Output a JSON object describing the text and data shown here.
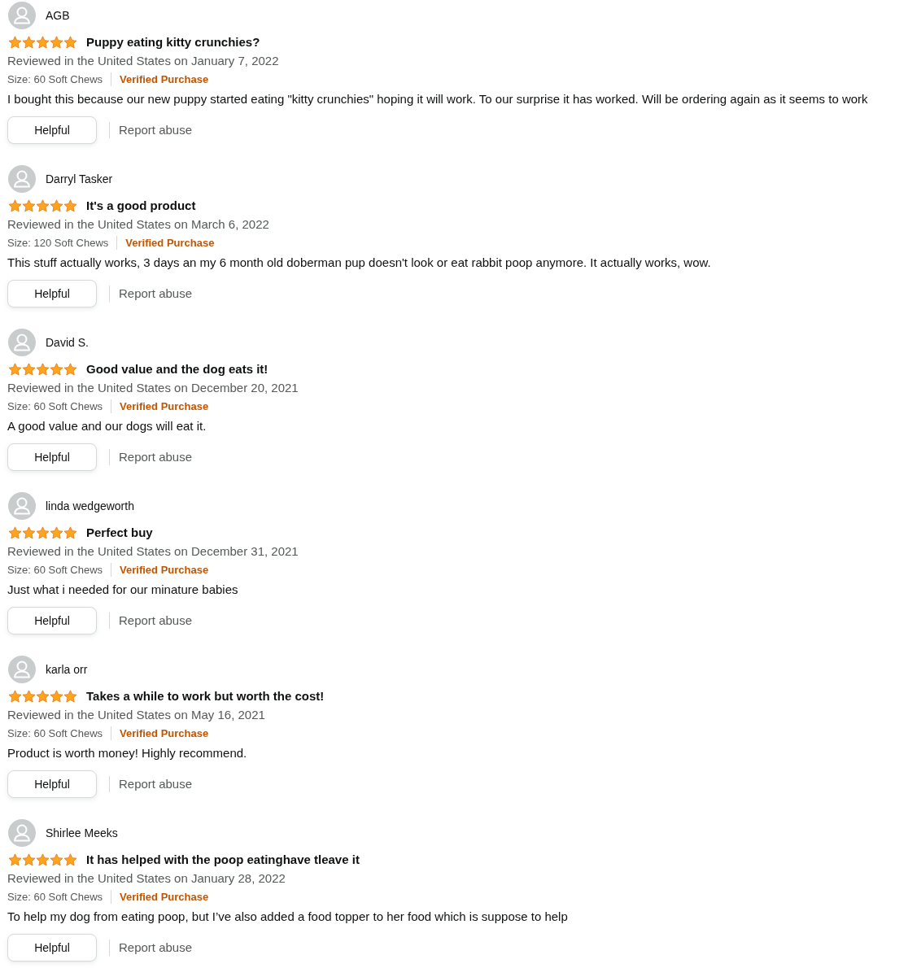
{
  "reviews": [
    {
      "reviewer": "AGB",
      "stars": 5,
      "title": "Puppy eating kitty crunchies?",
      "date": "Reviewed in the United States on January 7, 2022",
      "size": "Size: 60 Soft Chews",
      "verified": "Verified Purchase",
      "body": "I bought this because our new puppy started eating \"kitty crunchies\" hoping it will work. To our surprise it has worked. Will be ordering again as it seems to work",
      "helpful": "Helpful",
      "report": "Report abuse"
    },
    {
      "reviewer": "Darryl Tasker",
      "stars": 5,
      "title": "It's a good product",
      "date": "Reviewed in the United States on March 6, 2022",
      "size": "Size: 120 Soft Chews",
      "verified": "Verified Purchase",
      "body": "This stuff actually works, 3 days an my 6 month old doberman pup doesn't look or eat rabbit poop anymore. It actually works, wow.",
      "helpful": "Helpful",
      "report": "Report abuse"
    },
    {
      "reviewer": "David S.",
      "stars": 5,
      "title": "Good value and the dog eats it!",
      "date": "Reviewed in the United States on December 20, 2021",
      "size": "Size: 60 Soft Chews",
      "verified": "Verified Purchase",
      "body": "A good value and our dogs will eat it.",
      "helpful": "Helpful",
      "report": "Report abuse"
    },
    {
      "reviewer": "linda wedgeworth",
      "stars": 5,
      "title": "Perfect buy",
      "date": "Reviewed in the United States on December 31, 2021",
      "size": "Size: 60 Soft Chews",
      "verified": "Verified Purchase",
      "body": "Just what i needed for our minature babies",
      "helpful": "Helpful",
      "report": "Report abuse"
    },
    {
      "reviewer": "karla orr",
      "stars": 5,
      "title": "Takes a while to work but worth the cost!",
      "date": "Reviewed in the United States on May 16, 2021",
      "size": "Size: 60 Soft Chews",
      "verified": "Verified Purchase",
      "body": "Product is worth money! Highly recommend.",
      "helpful": "Helpful",
      "report": "Report abuse"
    },
    {
      "reviewer": "Shirlee Meeks",
      "stars": 5,
      "title": "It has helped with the poop eatinghave tleave it",
      "date": "Reviewed in the United States on January 28, 2022",
      "size": "Size: 60 Soft Chews",
      "verified": "Verified Purchase",
      "body": "To help my dog from eating poop, but I’ve also added a food topper to her food which is suppose to help",
      "helpful": "Helpful",
      "report": "Report abuse"
    }
  ]
}
